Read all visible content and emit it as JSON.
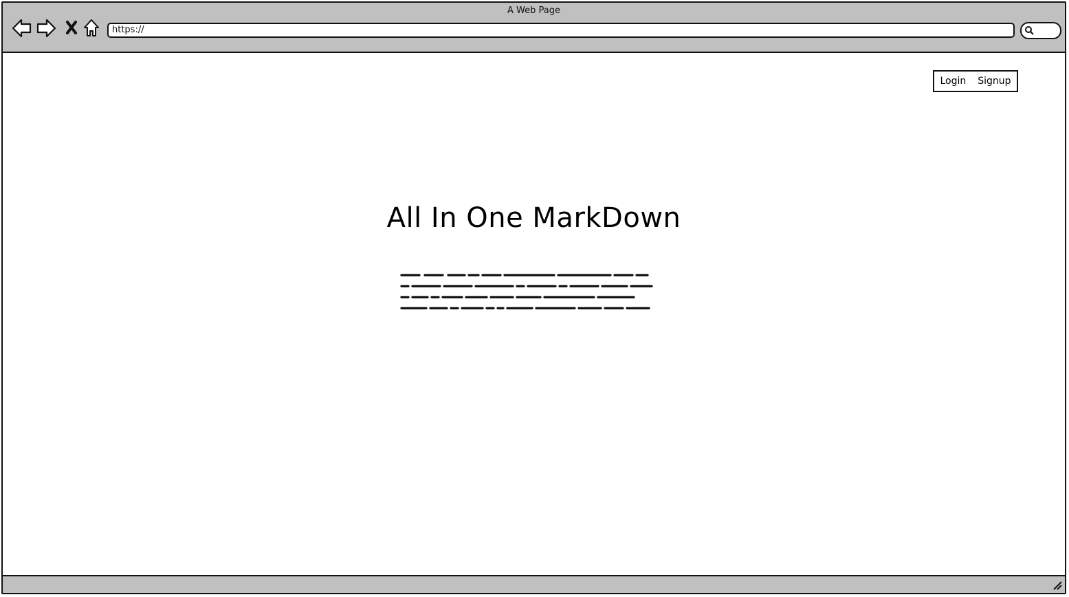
{
  "window": {
    "title": "A Web Page"
  },
  "browser": {
    "url": "https://",
    "nav_icons": [
      "back-arrow-icon",
      "forward-arrow-icon",
      "stop-icon",
      "home-icon"
    ],
    "search_icon": "search-icon"
  },
  "header": {
    "login_label": "Login",
    "signup_label": "Signup"
  },
  "hero": {
    "title": "All In One MarkDown",
    "placeholder_text": "scribbled lorem-ipsum placeholder paragraph (4 lines)"
  },
  "statusbar": {
    "grip_icon": "resize-grip-icon"
  }
}
